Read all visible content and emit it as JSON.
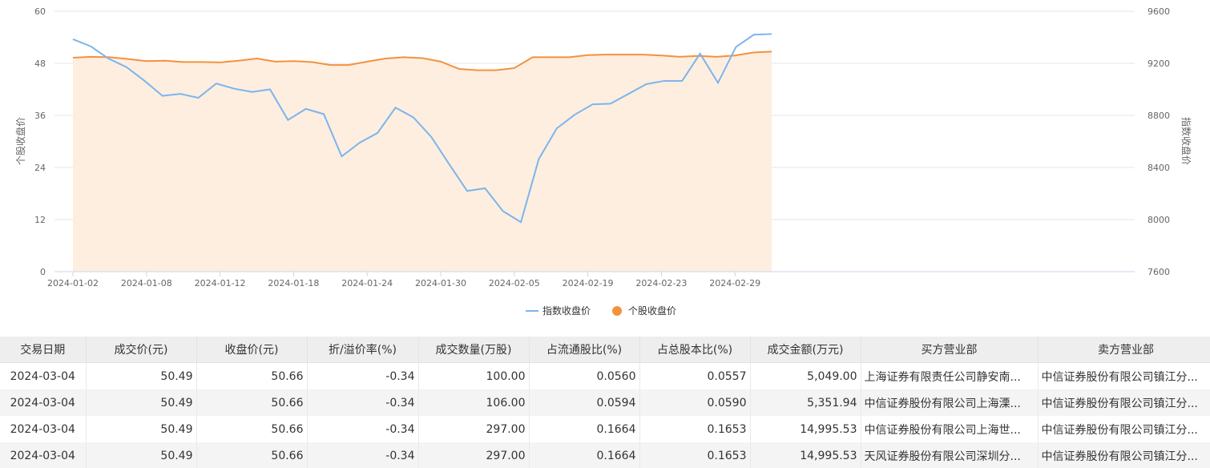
{
  "chart_data": {
    "type": "line",
    "ylabel_left": "个股收盘价",
    "ylabel_right": "指数收盘价",
    "ylim_left": [
      0,
      60
    ],
    "yticks_left": [
      0,
      12,
      24,
      36,
      48,
      60
    ],
    "ylim_right": [
      7600,
      9600
    ],
    "yticks_right": [
      7600,
      8000,
      8400,
      8800,
      9200,
      9600
    ],
    "x_categories": [
      "2024-01-02",
      "2024-01-03",
      "2024-01-04",
      "2024-01-05",
      "2024-01-08",
      "2024-01-09",
      "2024-01-10",
      "2024-01-11",
      "2024-01-12",
      "2024-01-15",
      "2024-01-16",
      "2024-01-17",
      "2024-01-18",
      "2024-01-19",
      "2024-01-22",
      "2024-01-23",
      "2024-01-24",
      "2024-01-25",
      "2024-01-26",
      "2024-01-29",
      "2024-01-30",
      "2024-01-31",
      "2024-02-01",
      "2024-02-02",
      "2024-02-05",
      "2024-02-06",
      "2024-02-07",
      "2024-02-08",
      "2024-02-19",
      "2024-02-20",
      "2024-02-21",
      "2024-02-22",
      "2024-02-23",
      "2024-02-26",
      "2024-02-27",
      "2024-02-28",
      "2024-02-29",
      "2024-03-01",
      "2024-03-04"
    ],
    "x_tick_labels": [
      "2024-01-02",
      "2024-01-08",
      "2024-01-12",
      "2024-01-18",
      "2024-01-24",
      "2024-01-30",
      "2024-02-05",
      "2024-02-19",
      "2024-02-23",
      "2024-02-29"
    ],
    "legend_position": "bottom-center",
    "grid": true,
    "series": [
      {
        "name": "指数收盘价",
        "axis": "right",
        "color": "#7cb5ec",
        "values": [
          9385,
          9330,
          9235,
          9170,
          9065,
          8950,
          8965,
          8935,
          9045,
          9005,
          8980,
          9000,
          8765,
          8850,
          8810,
          8485,
          8590,
          8665,
          8860,
          8785,
          8635,
          8425,
          8220,
          8240,
          8065,
          7980,
          8465,
          8700,
          8805,
          8885,
          8890,
          8965,
          9040,
          9065,
          9065,
          9275,
          9050,
          9325,
          9420,
          9425
        ]
      },
      {
        "name": "个股收盘价",
        "axis": "left",
        "color": "#f5913e",
        "area_fill": "#fdeee0",
        "values": [
          49.3,
          49.5,
          49.4,
          49.0,
          48.5,
          48.6,
          48.3,
          48.3,
          48.2,
          48.6,
          49.1,
          48.4,
          48.5,
          48.3,
          47.6,
          47.6,
          48.4,
          49.1,
          49.4,
          49.2,
          48.4,
          46.7,
          46.4,
          46.4,
          46.9,
          49.4,
          49.4,
          49.4,
          49.9,
          50.0,
          50.0,
          50.0,
          49.8,
          49.5,
          49.7,
          49.5,
          49.8,
          50.5,
          50.7
        ]
      }
    ]
  },
  "table": {
    "headers": [
      "交易日期",
      "成交价(元)",
      "收盘价(元)",
      "折/溢价率(%)",
      "成交数量(万股)",
      "占流通股比(%)",
      "占总股本比(%)",
      "成交金额(万元)",
      "买方营业部",
      "卖方营业部"
    ],
    "rows": [
      [
        "2024-03-04",
        "50.49",
        "50.66",
        "-0.34",
        "100.00",
        "0.0560",
        "0.0557",
        "5,049.00",
        "上海证券有限责任公司静安南...",
        "中信证券股份有限公司镇江分..."
      ],
      [
        "2024-03-04",
        "50.49",
        "50.66",
        "-0.34",
        "106.00",
        "0.0594",
        "0.0590",
        "5,351.94",
        "中信证券股份有限公司上海溧...",
        "中信证券股份有限公司镇江分..."
      ],
      [
        "2024-03-04",
        "50.49",
        "50.66",
        "-0.34",
        "297.00",
        "0.1664",
        "0.1653",
        "14,995.53",
        "中信证券股份有限公司上海世...",
        "中信证券股份有限公司镇江分..."
      ],
      [
        "2024-03-04",
        "50.49",
        "50.66",
        "-0.34",
        "297.00",
        "0.1664",
        "0.1653",
        "14,995.53",
        "天风证券股份有限公司深圳分...",
        "中信证券股份有限公司镇江分..."
      ]
    ]
  }
}
